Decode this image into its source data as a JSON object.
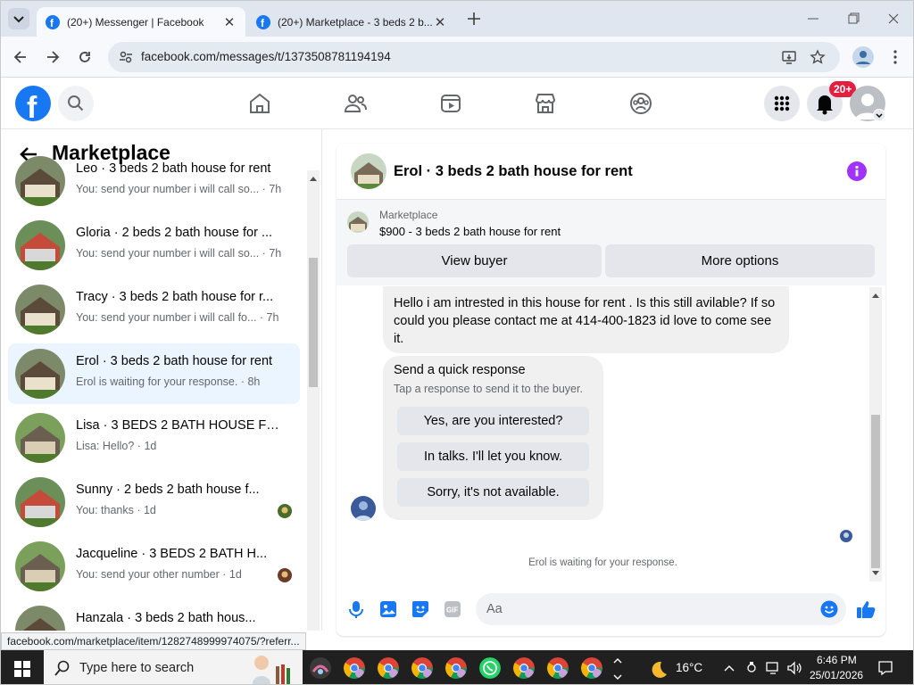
{
  "browser": {
    "tabs": [
      {
        "title": "(20+) Messenger | Facebook"
      },
      {
        "title": "(20+) Marketplace - 3 beds 2 b..."
      }
    ],
    "url": "facebook.com/messages/t/1373508781194194",
    "status_url": "facebook.com/marketplace/item/1282748999974075/?referr..."
  },
  "header": {
    "notif_badge": "20+"
  },
  "sidebar": {
    "title": "Marketplace",
    "conversations": [
      {
        "name": "Leo · 3 beds 2 bath house for rent",
        "preview": "You: send your number i will call so...",
        "time": "7h",
        "selected": false
      },
      {
        "name": "Gloria · 2 beds 2 bath house for ...",
        "preview": "You: send your number i will call so...",
        "time": "7h",
        "selected": false
      },
      {
        "name": "Tracy · 3 beds 2 bath house for r...",
        "preview": "You: send your number i will call fo...",
        "time": "7h",
        "selected": false
      },
      {
        "name": "Erol · 3 beds 2 bath house for rent",
        "preview": "Erol is waiting for your response.",
        "time": "8h",
        "selected": true
      },
      {
        "name": "Lisa · 3 BEDS 2 BATH HOUSE FO...",
        "preview": "Lisa: Hello?",
        "time": "1d",
        "selected": false
      },
      {
        "name": "Sunny · 2 beds 2 bath house f...",
        "preview": "You: thanks",
        "time": "1d",
        "selected": false
      },
      {
        "name": "Jacqueline · 3 BEDS 2 BATH H...",
        "preview": "You: send your other number",
        "time": "1d",
        "selected": false
      },
      {
        "name": "Hanzala · 3 beds 2 bath hous...",
        "preview": "",
        "time": "",
        "selected": false
      }
    ]
  },
  "chat": {
    "title": "Erol · 3 beds 2 bath house for rent",
    "listing_label": "Marketplace",
    "listing_detail": "$900 - 3 beds 2 bath house for rent",
    "view_buyer": "View buyer",
    "more_options": "More options",
    "message": "Hello i am intrested in this house for rent . Is this still avilable? If so could you please contact me at 414-400-1823 id love to come see it.",
    "quick_title": "Send a quick response",
    "quick_subtitle": "Tap a response to send it to the buyer.",
    "quick_replies": [
      "Yes, are you interested?",
      "In talks. I'll let you know.",
      "Sorry, it's not available."
    ],
    "waiting_text": "Erol is waiting for your response.",
    "composer_placeholder": "Aa"
  },
  "taskbar": {
    "search_placeholder": "Type here to search",
    "temperature": "16°C",
    "time": "6:46 PM",
    "date": "25/01/2026"
  },
  "colors": {
    "fb_blue": "#1877f2",
    "badge_red": "#e41e3f",
    "info_purple": "#a033ff",
    "selected_row": "#ebf5ff"
  }
}
